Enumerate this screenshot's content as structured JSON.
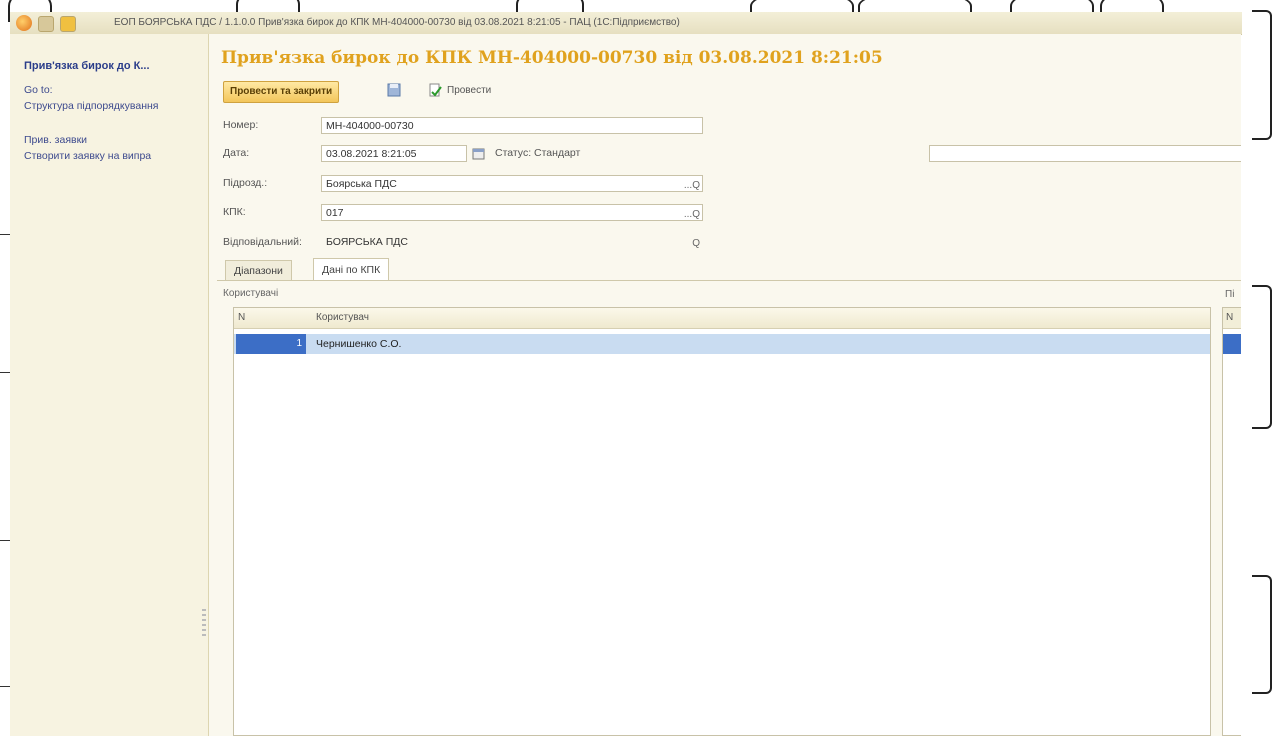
{
  "window": {
    "title": "ЕОП БОЯРСЬКА ПДС / 1.1.0.0 Прив'язка бирок до КПК МН-404000-00730 від 03.08.2021 8:21:05 - ПАЦ (1С:Підприємство)"
  },
  "sidebar": {
    "title": "Прив'язка бирок до К...",
    "items": [
      {
        "label": "Go to:"
      },
      {
        "label": "Структура підпорядкування"
      },
      {
        "label": "Прив. заявки"
      },
      {
        "label": "Створити заявку на випра"
      }
    ]
  },
  "page_title": "Прив'язка бирок до КПК МН-404000-00730 від 03.08.2021 8:21:05",
  "toolbar": {
    "post_close_label": "Провести та закрити",
    "post_label": "Провести"
  },
  "form": {
    "number": {
      "label": "Номер:",
      "value": "МН-404000-00730"
    },
    "date": {
      "label": "Дата:",
      "value": "03.08.2021  8:21:05"
    },
    "status": {
      "label": "Статус:",
      "value": "Стандарт"
    },
    "subdivision": {
      "label": "Підрозд.:",
      "value": "Боярська ПДС"
    },
    "kpk": {
      "label": "КПК:",
      "value": "017"
    },
    "responsible": {
      "label": "Відповідальний:",
      "value": "БОЯРСЬКА ПДС"
    }
  },
  "tabs": [
    {
      "label": "Діапазони"
    },
    {
      "label": "Дані по КПК"
    }
  ],
  "users_table": {
    "section_label": "Користувачі",
    "columns": [
      "N",
      "Користувач"
    ],
    "rows": [
      {
        "n": "1",
        "user": "Чернишенко С.О."
      }
    ]
  },
  "right_table": {
    "section_label": "Пі",
    "column": "N"
  }
}
